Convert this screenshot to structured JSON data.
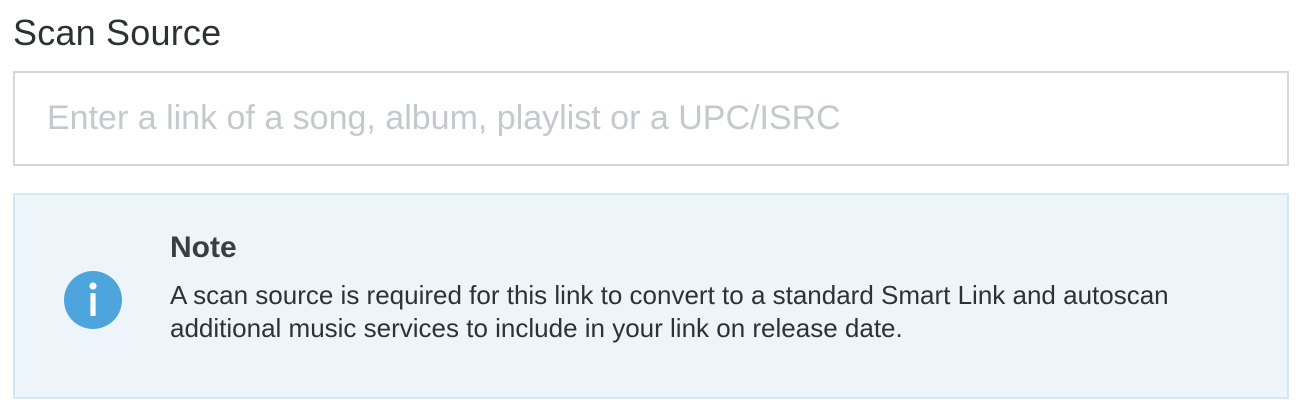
{
  "scan_source": {
    "title": "Scan Source",
    "input": {
      "value": "",
      "placeholder": "Enter a link of a song, album, playlist or a UPC/ISRC"
    }
  },
  "note": {
    "icon": "info-icon",
    "title": "Note",
    "body": "A scan source is required for this link to convert to a standard Smart Link and autoscan additional music services to include in your link on release date."
  },
  "colors": {
    "info_icon": "#4ea4dc",
    "note_background": "#edf5fb",
    "note_border": "#d2e6f3",
    "input_border": "#d5d7da"
  }
}
